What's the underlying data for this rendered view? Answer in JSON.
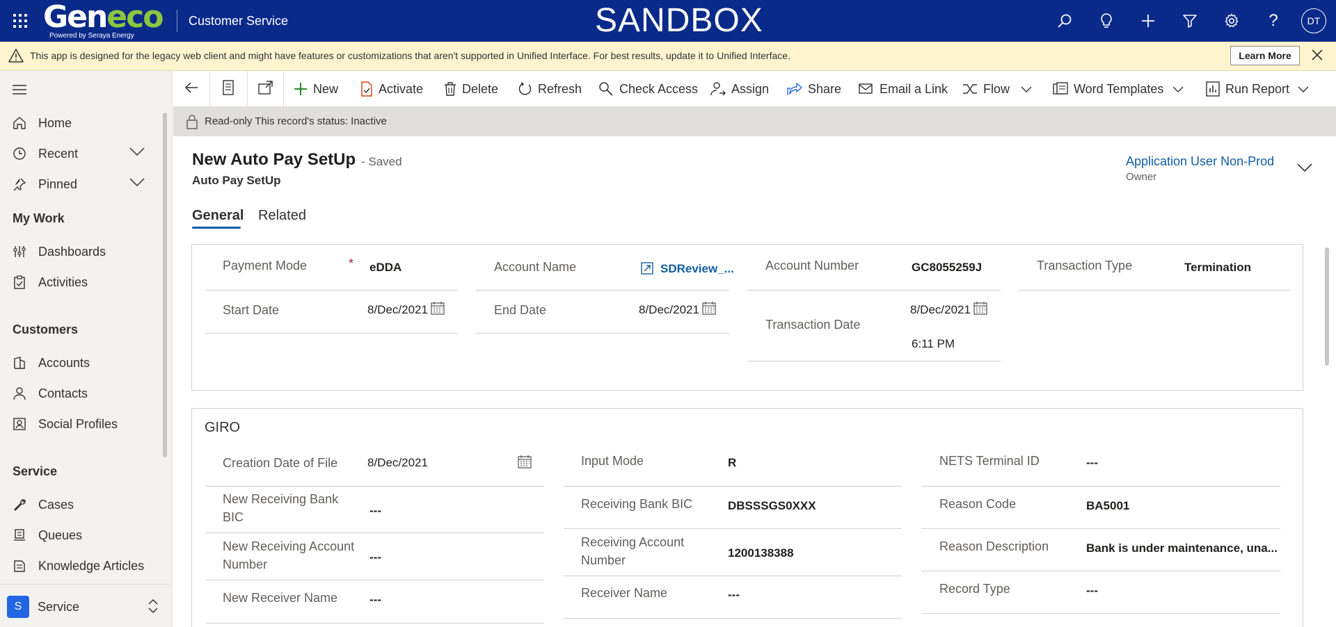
{
  "topbar": {
    "brand_main_g": "Gen",
    "brand_main_eco": "eco",
    "brand_sub": "Powered by Seraya Energy",
    "app_name": "Customer Service",
    "environment": "SANDBOX",
    "user_initials": "DT",
    "icons": [
      "search-icon",
      "lightbulb-icon",
      "plus-icon",
      "filter-icon",
      "gear-icon",
      "help-icon"
    ]
  },
  "warning": {
    "text": "This app is designed for the legacy web client and might have features or customizations that aren't supported in Unified Interface. For best results, update it to Unified Interface.",
    "learn_more": "Learn More"
  },
  "sidebar": {
    "items": [
      {
        "label": "Home",
        "icon": "home-icon"
      },
      {
        "label": "Recent",
        "icon": "clock-icon"
      },
      {
        "label": "Pinned",
        "icon": "pin-icon"
      }
    ],
    "sections": [
      {
        "title": "My Work",
        "items": [
          {
            "label": "Dashboards",
            "icon": "dashboard-icon"
          },
          {
            "label": "Activities",
            "icon": "clipboard-icon"
          }
        ]
      },
      {
        "title": "Customers",
        "items": [
          {
            "label": "Accounts",
            "icon": "building-icon"
          },
          {
            "label": "Contacts",
            "icon": "person-icon"
          },
          {
            "label": "Social Profiles",
            "icon": "profile-icon"
          }
        ]
      },
      {
        "title": "Service",
        "items": [
          {
            "label": "Cases",
            "icon": "wrench-icon"
          },
          {
            "label": "Queues",
            "icon": "queue-icon"
          },
          {
            "label": "Knowledge Articles",
            "icon": "book-icon"
          }
        ]
      }
    ],
    "area": {
      "badge": "S",
      "name": "Service"
    }
  },
  "commands": {
    "new": "New",
    "activate": "Activate",
    "delete": "Delete",
    "refresh": "Refresh",
    "check_access": "Check Access",
    "assign": "Assign",
    "share": "Share",
    "email_link": "Email a Link",
    "flow": "Flow",
    "word_templates": "Word Templates",
    "run_report": "Run Report"
  },
  "readonly": {
    "text": "Read-only  This record's status: Inactive"
  },
  "record": {
    "title": "New Auto Pay SetUp",
    "saved": "- Saved",
    "entity": "Auto Pay SetUp",
    "owner_name": "Application User Non-Prod",
    "owner_label": "Owner"
  },
  "tabs": [
    "General",
    "Related"
  ],
  "general": {
    "payment_mode_label": "Payment Mode",
    "payment_mode_required": "*",
    "payment_mode": "eDDA",
    "account_name_label": "Account Name",
    "account_name": "SDReview_...",
    "account_number_label": "Account Number",
    "account_number": "GC8055259J",
    "transaction_type_label": "Transaction Type",
    "transaction_type": "Termination",
    "start_date_label": "Start Date",
    "start_date": "8/Dec/2021",
    "end_date_label": "End Date",
    "end_date": "8/Dec/2021",
    "transaction_date_label": "Transaction Date",
    "transaction_date": "8/Dec/2021",
    "transaction_time": "6:11 PM"
  },
  "giro": {
    "title": "GIRO",
    "creation_date_label": "Creation Date of File",
    "creation_date": "8/Dec/2021",
    "new_receiving_bank_bic_label": "New Receiving Bank BIC",
    "new_receiving_bank_bic": "---",
    "new_receiving_account_label": "New Receiving Account Number",
    "new_receiving_account": "---",
    "new_receiver_name_label": "New Receiver Name",
    "new_receiver_name": "---",
    "input_mode_label": "Input Mode",
    "input_mode": "R",
    "receiving_bank_bic_label": "Receiving Bank BIC",
    "receiving_bank_bic": "DBSSSGS0XXX",
    "receiving_account_label": "Receiving Account Number",
    "receiving_account": "1200138388",
    "receiver_name_label": "Receiver Name",
    "receiver_name": "---",
    "nets_terminal_label": "NETS Terminal ID",
    "nets_terminal": "---",
    "reason_code_label": "Reason Code",
    "reason_code": "BA5001",
    "reason_desc_label": "Reason Description",
    "reason_desc": "Bank is under maintenance, una...",
    "record_type_label": "Record Type",
    "record_type": "---"
  }
}
